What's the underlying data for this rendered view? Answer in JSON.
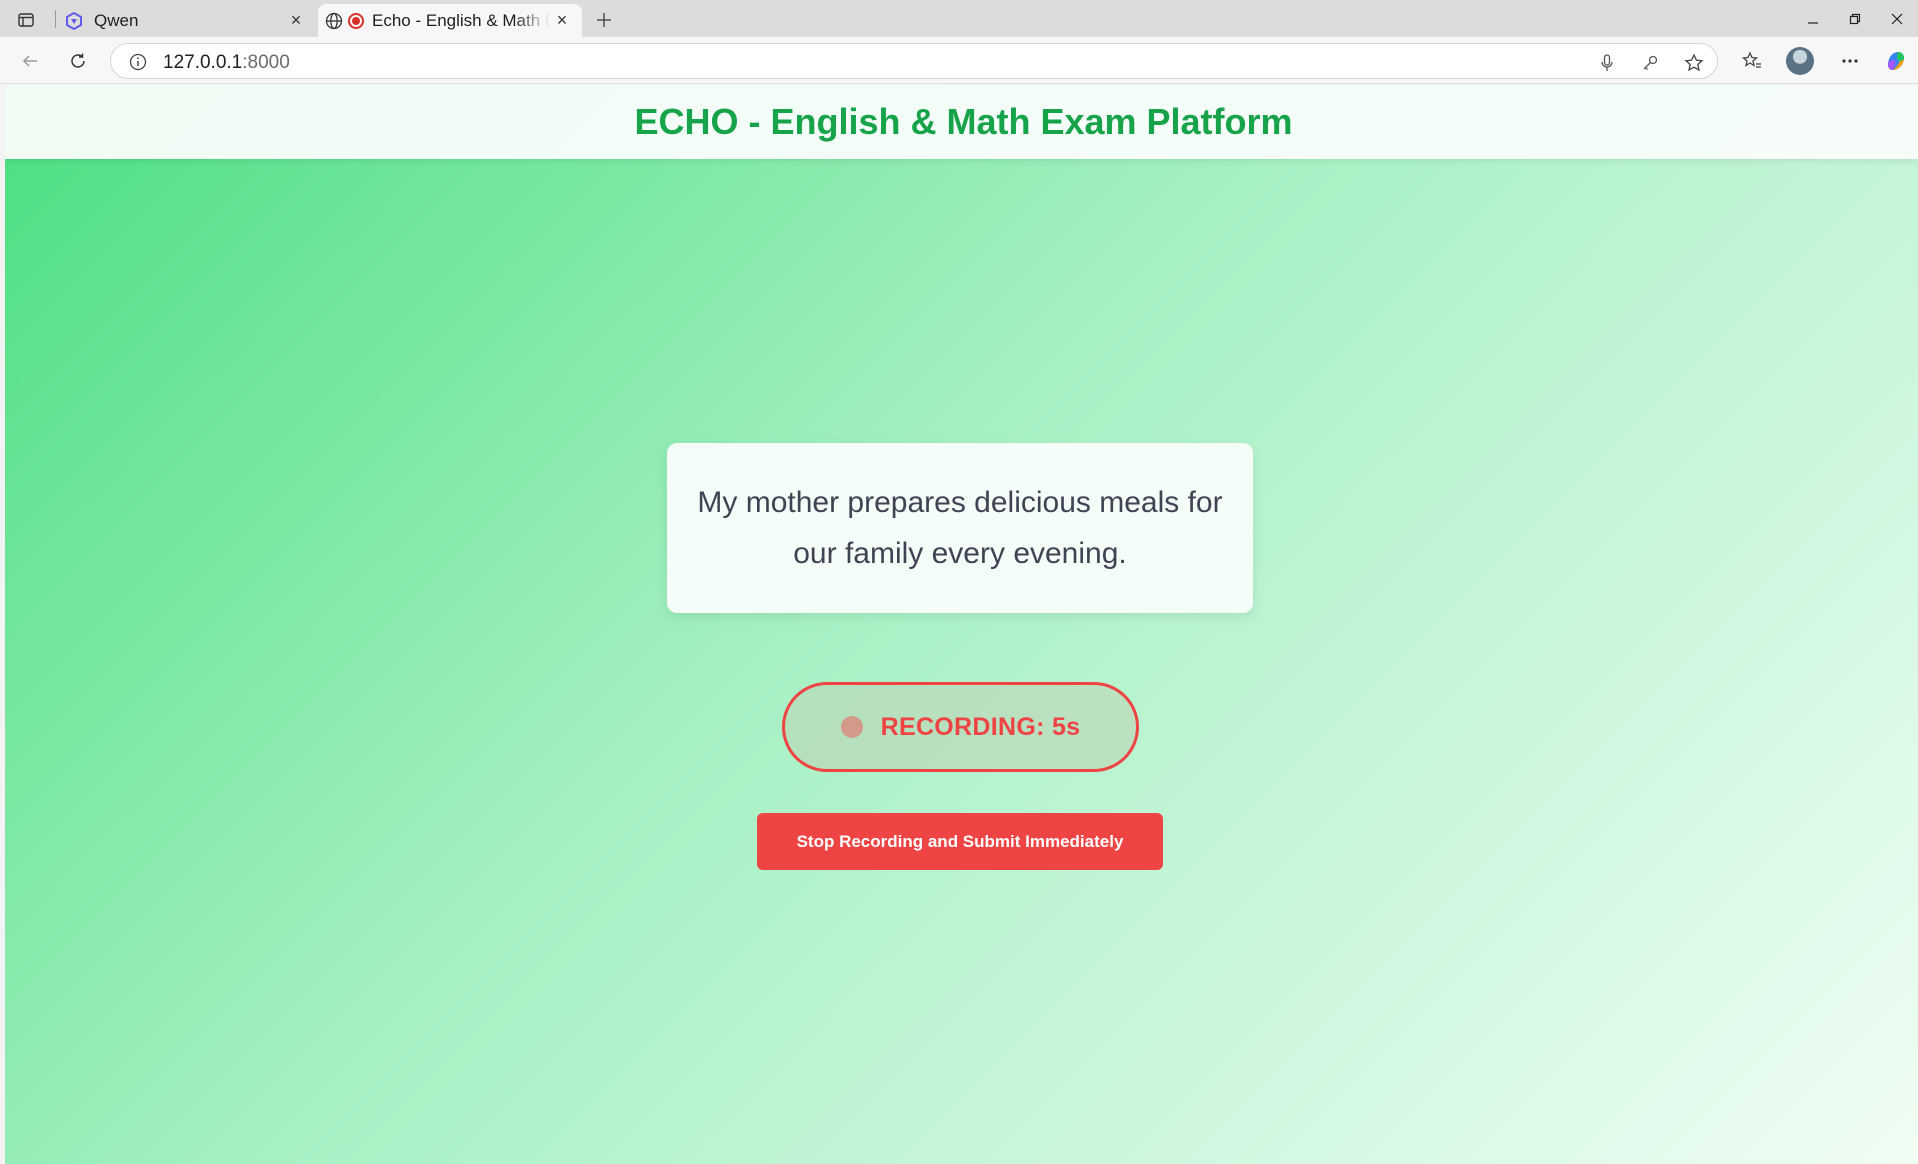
{
  "browser": {
    "tabs": [
      {
        "title": "Qwen",
        "favicon": "qwen-logo-icon",
        "active": false
      },
      {
        "title": "Echo - English & Math Exam Platform",
        "favicon": "globe-icon",
        "indicator": "recording-dot-icon",
        "active": true
      }
    ],
    "address": {
      "host": "127.0.0.1",
      "port": ":8000"
    }
  },
  "page": {
    "title": "ECHO - English & Math Exam Platform",
    "sentence": "My mother prepares delicious meals for our family every evening.",
    "recording": {
      "label": "RECORDING: 5s",
      "seconds": 5
    },
    "stop_button_label": "Stop Recording and Submit Immediately"
  },
  "colors": {
    "brand_green": "#16a34a",
    "record_red": "#ef4444",
    "text_dark": "#3f4454"
  }
}
